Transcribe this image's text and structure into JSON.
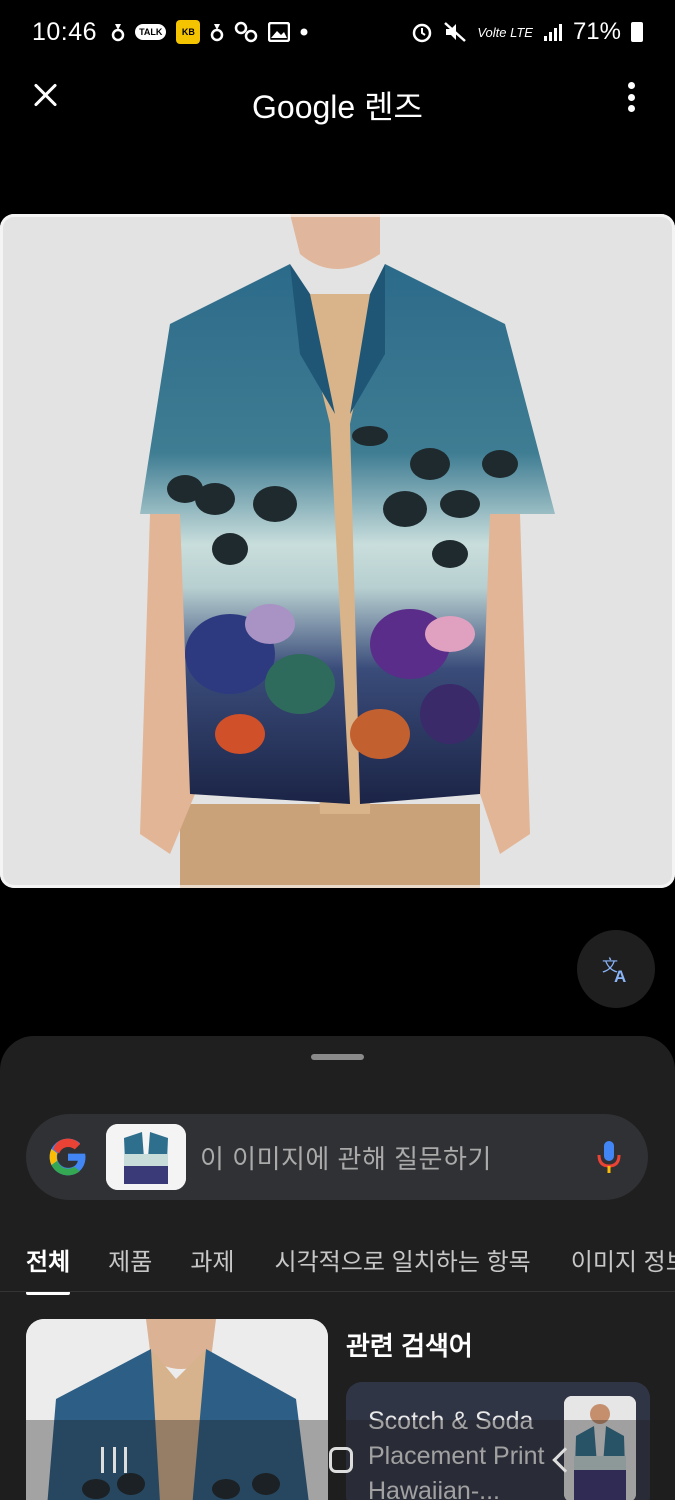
{
  "status_bar": {
    "time": "10:46",
    "talk_label": "TALK",
    "kb_label": "KB",
    "network_label": "Volte LTE",
    "battery": "71%"
  },
  "header": {
    "title_brand": "Google",
    "title_product": "렌즈"
  },
  "photo": {
    "subject": "Hawaiian shirt with underwater coral print"
  },
  "search": {
    "placeholder": "이 이미지에 관해 질문하기"
  },
  "tabs": [
    {
      "label": "전체",
      "active": true
    },
    {
      "label": "제품",
      "active": false
    },
    {
      "label": "과제",
      "active": false
    },
    {
      "label": "시각적으로 일치하는 항목",
      "active": false
    },
    {
      "label": "이미지 정보",
      "active": false
    }
  ],
  "related": {
    "title": "관련 검색어",
    "card_text": "Scotch & Soda Placement Print Hawaiian-..."
  },
  "colors": {
    "background": "#000000",
    "sheet": "#1f1f1f",
    "search_bar": "#303134",
    "related_card": "#303546",
    "google_blue": "#4285F4",
    "google_red": "#EA4335",
    "google_yellow": "#FBBC05",
    "google_green": "#34A853"
  }
}
